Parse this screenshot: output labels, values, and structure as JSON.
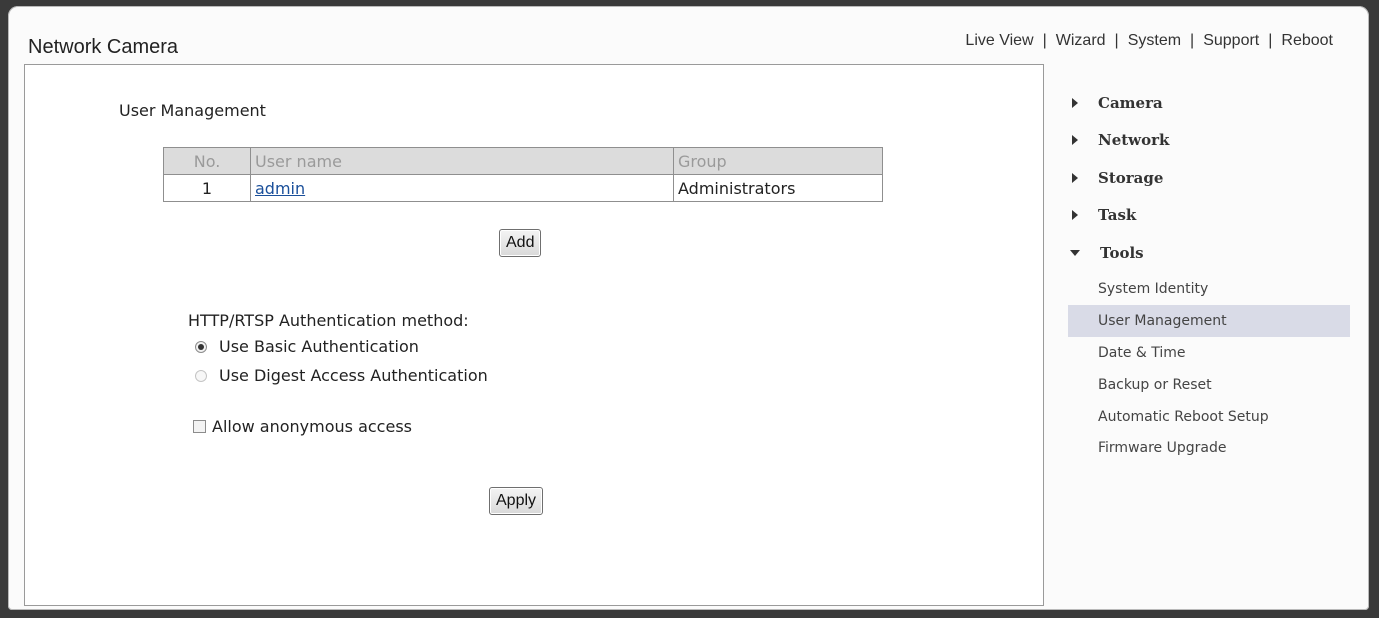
{
  "header": {
    "title": "Network Camera",
    "nav": [
      "Live View",
      "Wizard",
      "System",
      "Support",
      "Reboot"
    ],
    "separator": "|"
  },
  "main": {
    "section_title": "User Management",
    "table": {
      "columns": [
        "No.",
        "User name",
        "Group"
      ],
      "rows": [
        {
          "no": "1",
          "user": "admin",
          "group": "Administrators"
        }
      ]
    },
    "add_label": "Add",
    "auth_label": "HTTP/RTSP Authentication method:",
    "auth_options": [
      {
        "label": "Use Basic Authentication",
        "selected": true
      },
      {
        "label": "Use Digest Access Authentication",
        "selected": false
      }
    ],
    "anonymous_label": "Allow anonymous access",
    "anonymous_checked": false,
    "apply_label": "Apply"
  },
  "sidebar": {
    "items": [
      "Camera",
      "Network",
      "Storage",
      "Task",
      "Tools"
    ],
    "expanded": "Tools",
    "subitems": [
      "System Identity",
      "User Management",
      "Date & Time",
      "Backup or Reset",
      "Automatic Reboot Setup",
      "Firmware Upgrade"
    ],
    "active_subitem": "User Management"
  },
  "colors": {
    "link": "#1a4f9a",
    "active_highlight": "#d9dbe7",
    "table_header_bg": "#dcdcdc"
  }
}
